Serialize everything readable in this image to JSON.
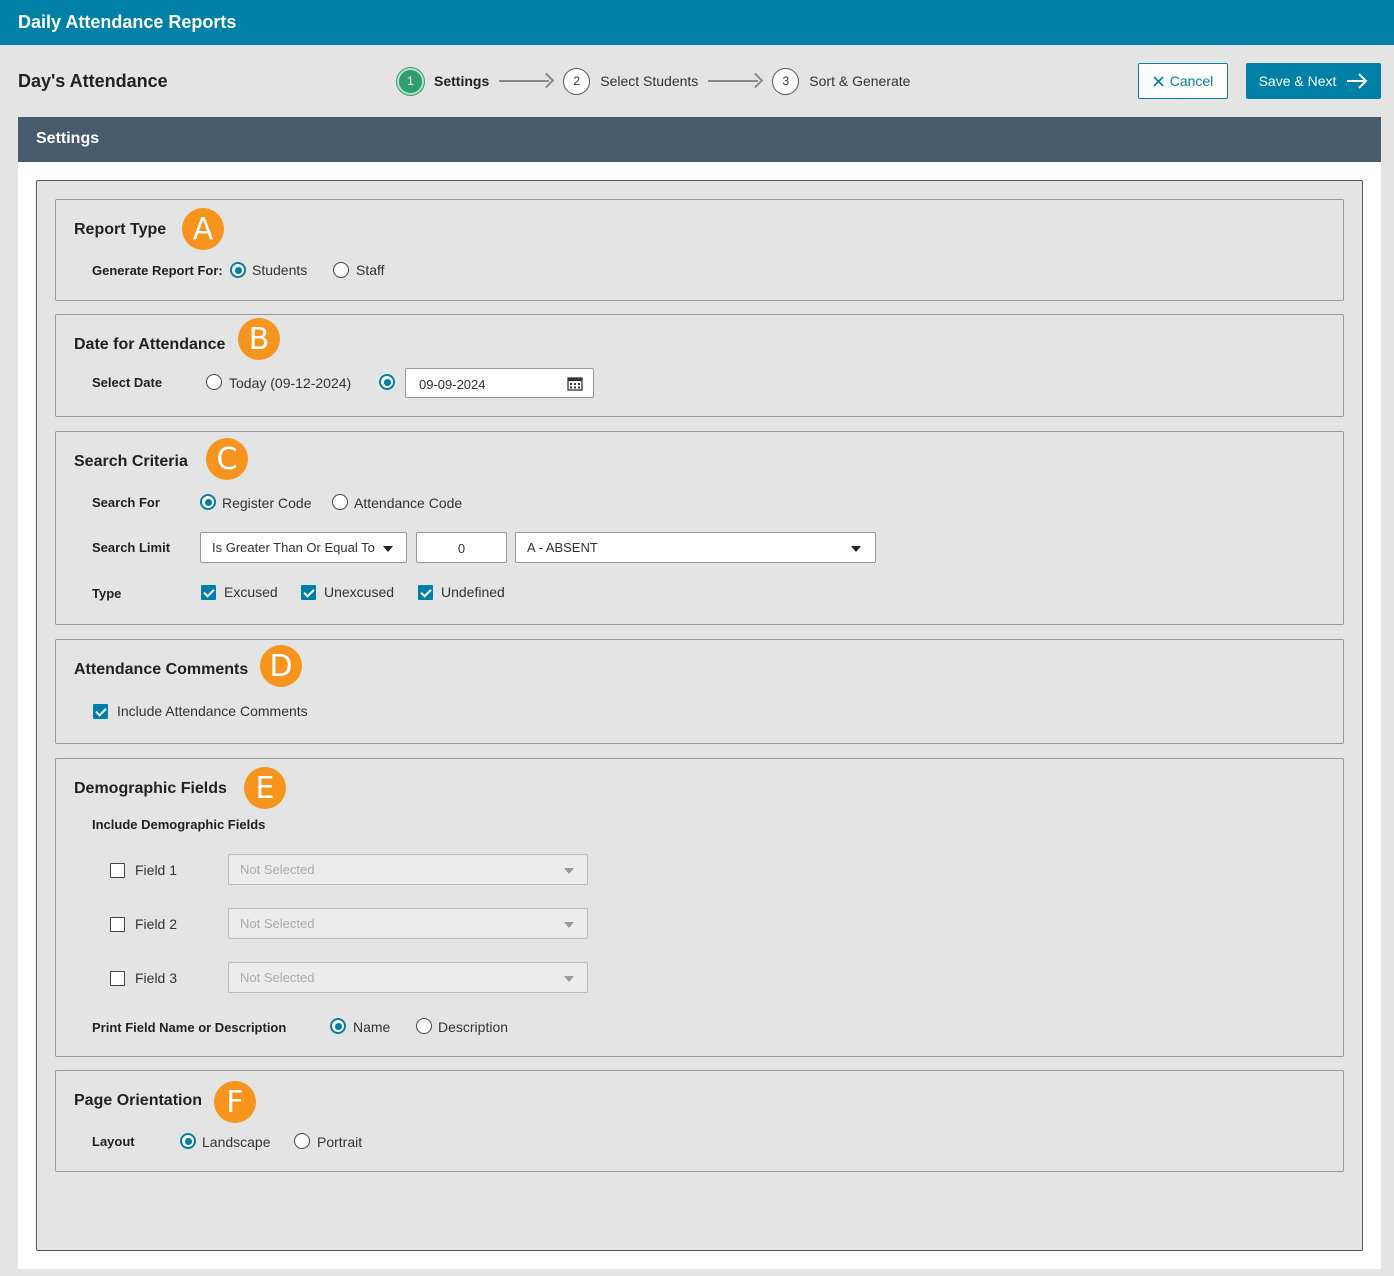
{
  "app": {
    "title": "Daily Attendance Reports"
  },
  "page": {
    "title": "Day's Attendance"
  },
  "steps": [
    {
      "number": "1",
      "label": "Settings",
      "active": true
    },
    {
      "number": "2",
      "label": "Select Students",
      "active": false
    },
    {
      "number": "3",
      "label": "Sort & Generate",
      "active": false
    }
  ],
  "actions": {
    "cancel_label": "Cancel",
    "save_label": "Save & Next"
  },
  "panel": {
    "title": "Settings"
  },
  "sections": {
    "report_type": {
      "title": "Report Type",
      "badge": "A",
      "generate_label": "Generate Report For:",
      "options": [
        "Students",
        "Staff"
      ],
      "selected": "Students"
    },
    "date": {
      "title": "Date for Attendance",
      "badge": "B",
      "select_label": "Select Date",
      "today_option": "Today (09-12-2024)",
      "custom_date": "09-09-2024",
      "selected": "custom"
    },
    "search": {
      "title": "Search Criteria",
      "badge": "C",
      "search_for_label": "Search For",
      "options": [
        "Register Code",
        "Attendance Code"
      ],
      "selected": "Register Code",
      "limit_label": "Search Limit",
      "limit_operator": "Is Greater Than Or Equal To",
      "limit_value": "0",
      "limit_code": "A - ABSENT",
      "type_label": "Type",
      "types": [
        {
          "label": "Excused",
          "checked": true
        },
        {
          "label": "Unexcused",
          "checked": true
        },
        {
          "label": "Undefined",
          "checked": true
        }
      ]
    },
    "comments": {
      "title": "Attendance Comments",
      "badge": "D",
      "include_label": "Include Attendance Comments",
      "checked": true
    },
    "demographic": {
      "title": "Demographic Fields",
      "badge": "E",
      "include_label": "Include Demographic Fields",
      "fields": [
        {
          "label": "Field 1",
          "value": "Not Selected",
          "checked": false
        },
        {
          "label": "Field 2",
          "value": "Not Selected",
          "checked": false
        },
        {
          "label": "Field 3",
          "value": "Not Selected",
          "checked": false
        }
      ],
      "print_label": "Print Field Name or Description",
      "print_options": [
        "Name",
        "Description"
      ],
      "print_selected": "Name"
    },
    "orientation": {
      "title": "Page Orientation",
      "badge": "F",
      "layout_label": "Layout",
      "options": [
        "Landscape",
        "Portrait"
      ],
      "selected": "Landscape"
    }
  },
  "colors": {
    "header": "#0080a6",
    "panel_header": "#475b6c",
    "badge": "#f7941d",
    "step_active": "#2f9e6e"
  }
}
